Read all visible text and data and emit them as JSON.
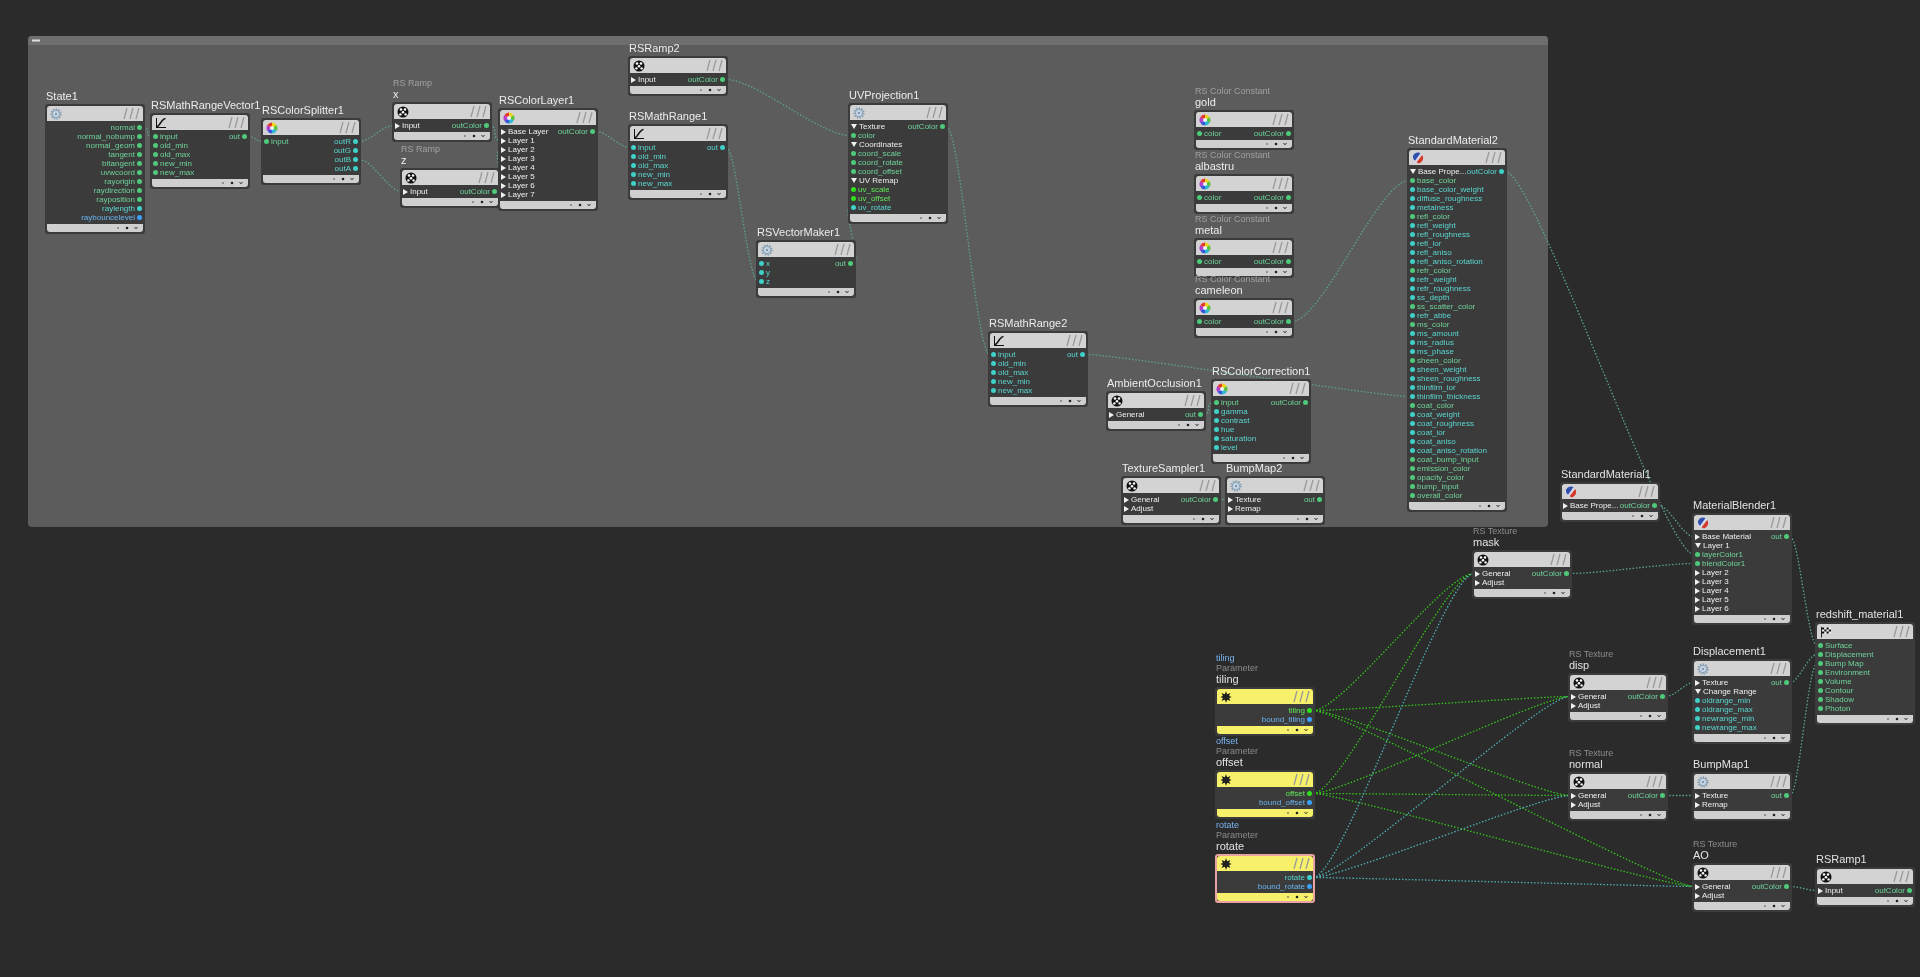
{
  "nodes": [
    {
      "name": "State1",
      "kind": "utility",
      "selected": false,
      "outputs": [
        {
          "label": "normal",
          "kind": "vector"
        },
        {
          "label": "normal_nobump",
          "kind": "vector"
        },
        {
          "label": "normal_geom",
          "kind": "vector"
        },
        {
          "label": "tangent",
          "kind": "vector"
        },
        {
          "label": "bitangent",
          "kind": "vector"
        },
        {
          "label": "uvwcoord",
          "kind": "vector"
        },
        {
          "label": "rayorigin",
          "kind": "vector"
        },
        {
          "label": "raydirection",
          "kind": "vector"
        },
        {
          "label": "rayposition",
          "kind": "vector"
        },
        {
          "label": "raylength",
          "kind": "float"
        },
        {
          "label": "raybouncelevel",
          "kind": "int"
        }
      ]
    },
    {
      "name": "RSMathRangeVector1",
      "kind": "math",
      "selected": false,
      "inputs": [
        {
          "label": "input",
          "kind": "vector"
        },
        {
          "label": "old_min",
          "kind": "vector"
        },
        {
          "label": "old_max",
          "kind": "vector"
        },
        {
          "label": "new_min",
          "kind": "vector"
        },
        {
          "label": "new_max",
          "kind": "vector"
        }
      ],
      "outputs": [
        {
          "label": "out",
          "kind": "vector"
        }
      ]
    },
    {
      "name": "RSColorSplitter1",
      "kind": "color",
      "selected": false,
      "inputs": [
        {
          "label": "input",
          "kind": "vector"
        }
      ],
      "outputs": [
        {
          "label": "outR",
          "kind": "float"
        },
        {
          "label": "outG",
          "kind": "float"
        },
        {
          "label": "outB",
          "kind": "float"
        },
        {
          "label": "outA",
          "kind": "float"
        }
      ]
    },
    {
      "name": "x",
      "type_label": "RS Ramp",
      "kind": "sampler",
      "selected": false,
      "inputs": [
        {
          "label": "Input",
          "kind": "branch"
        }
      ],
      "outputs": [
        {
          "label": "outColor",
          "kind": "vector"
        }
      ]
    },
    {
      "name": "z",
      "type_label": "RS Ramp",
      "kind": "sampler",
      "selected": false,
      "inputs": [
        {
          "label": "Input",
          "kind": "branch"
        }
      ],
      "outputs": [
        {
          "label": "outColor",
          "kind": "vector"
        }
      ]
    },
    {
      "name": "RSColorLayer1",
      "kind": "color",
      "selected": false,
      "inputs": [
        {
          "label": "Base Layer",
          "kind": "branch"
        },
        {
          "label": "Layer 1",
          "kind": "branch"
        },
        {
          "label": "Layer 2",
          "kind": "branch"
        },
        {
          "label": "Layer 3",
          "kind": "branch"
        },
        {
          "label": "Layer 4",
          "kind": "branch"
        },
        {
          "label": "Layer 5",
          "kind": "branch"
        },
        {
          "label": "Layer 6",
          "kind": "branch"
        },
        {
          "label": "Layer 7",
          "kind": "branch"
        }
      ],
      "outputs": [
        {
          "label": "outColor",
          "kind": "vector"
        }
      ]
    },
    {
      "name": "RSRamp2",
      "kind": "sampler",
      "selected": false,
      "inputs": [
        {
          "label": "Input",
          "kind": "branch"
        }
      ],
      "outputs": [
        {
          "label": "outColor",
          "kind": "vector"
        }
      ]
    },
    {
      "name": "RSMathRange1",
      "kind": "math",
      "selected": false,
      "inputs": [
        {
          "label": "input",
          "kind": "float"
        },
        {
          "label": "old_min",
          "kind": "float"
        },
        {
          "label": "old_max",
          "kind": "float"
        },
        {
          "label": "new_min",
          "kind": "float"
        },
        {
          "label": "new_max",
          "kind": "float"
        }
      ],
      "outputs": [
        {
          "label": "out",
          "kind": "float"
        }
      ]
    },
    {
      "name": "UVProjection1",
      "kind": "utility",
      "selected": false,
      "inputs": [
        {
          "label": "Texture",
          "kind": "section"
        },
        {
          "label": "color",
          "kind": "vector"
        },
        {
          "label": "Coordinates",
          "kind": "section"
        },
        {
          "label": "coord_scale",
          "kind": "vector"
        },
        {
          "label": "coord_rotate",
          "kind": "vector"
        },
        {
          "label": "coord_offset",
          "kind": "vector"
        },
        {
          "label": "UV Remap",
          "kind": "section"
        },
        {
          "label": "uv_scale",
          "kind": "bright"
        },
        {
          "label": "uv_offset",
          "kind": "bright"
        },
        {
          "label": "uv_rotate",
          "kind": "float"
        }
      ],
      "outputs": [
        {
          "label": "outColor",
          "kind": "vector"
        }
      ]
    },
    {
      "name": "RSVectorMaker1",
      "kind": "utility",
      "selected": false,
      "inputs": [
        {
          "label": "x",
          "kind": "float"
        },
        {
          "label": "y",
          "kind": "float"
        },
        {
          "label": "z",
          "kind": "float"
        }
      ],
      "outputs": [
        {
          "label": "out",
          "kind": "vector"
        }
      ]
    },
    {
      "name": "gold",
      "type_label": "RS Color Constant",
      "kind": "color",
      "selected": false,
      "inputs": [
        {
          "label": "color",
          "kind": "vector"
        }
      ],
      "outputs": [
        {
          "label": "outColor",
          "kind": "vector"
        }
      ]
    },
    {
      "name": "albastru",
      "type_label": "RS Color Constant",
      "kind": "color",
      "selected": false,
      "inputs": [
        {
          "label": "color",
          "kind": "vector"
        }
      ],
      "outputs": [
        {
          "label": "outColor",
          "kind": "vector"
        }
      ]
    },
    {
      "name": "metal",
      "type_label": "RS Color Constant",
      "kind": "color",
      "selected": false,
      "inputs": [
        {
          "label": "color",
          "kind": "vector"
        }
      ],
      "outputs": [
        {
          "label": "outColor",
          "kind": "vector"
        }
      ]
    },
    {
      "name": "cameleon",
      "type_label": "RS Color Constant",
      "kind": "color",
      "selected": false,
      "inputs": [
        {
          "label": "color",
          "kind": "vector"
        }
      ],
      "outputs": [
        {
          "label": "outColor",
          "kind": "vector"
        }
      ]
    },
    {
      "name": "StandardMaterial2",
      "kind": "material",
      "selected": false,
      "inputs": [
        {
          "label": "Base Prope...",
          "kind": "section"
        },
        {
          "label": "base_color",
          "kind": "vector"
        },
        {
          "label": "base_color_weight",
          "kind": "float"
        },
        {
          "label": "diffuse_roughness",
          "kind": "float"
        },
        {
          "label": "metalness",
          "kind": "float"
        },
        {
          "label": "refl_color",
          "kind": "vector"
        },
        {
          "label": "refl_weight",
          "kind": "float"
        },
        {
          "label": "refl_roughness",
          "kind": "float"
        },
        {
          "label": "refl_ior",
          "kind": "float"
        },
        {
          "label": "refl_aniso",
          "kind": "float"
        },
        {
          "label": "refl_aniso_rotation",
          "kind": "float"
        },
        {
          "label": "refr_color",
          "kind": "vector"
        },
        {
          "label": "refr_weight",
          "kind": "float"
        },
        {
          "label": "refr_roughness",
          "kind": "float"
        },
        {
          "label": "ss_depth",
          "kind": "float"
        },
        {
          "label": "ss_scatter_color",
          "kind": "vector"
        },
        {
          "label": "refr_abbe",
          "kind": "float"
        },
        {
          "label": "ms_color",
          "kind": "vector"
        },
        {
          "label": "ms_amount",
          "kind": "float"
        },
        {
          "label": "ms_radius",
          "kind": "float"
        },
        {
          "label": "ms_phase",
          "kind": "float"
        },
        {
          "label": "sheen_color",
          "kind": "vector"
        },
        {
          "label": "sheen_weight",
          "kind": "float"
        },
        {
          "label": "sheen_roughness",
          "kind": "float"
        },
        {
          "label": "thinfilm_ior",
          "kind": "float"
        },
        {
          "label": "thinfilm_thickness",
          "kind": "float"
        },
        {
          "label": "coat_color",
          "kind": "vector"
        },
        {
          "label": "coat_weight",
          "kind": "float"
        },
        {
          "label": "coat_roughness",
          "kind": "float"
        },
        {
          "label": "coat_ior",
          "kind": "float"
        },
        {
          "label": "coat_aniso",
          "kind": "float"
        },
        {
          "label": "coat_aniso_rotation",
          "kind": "float"
        },
        {
          "label": "coat_bump_input",
          "kind": "vector"
        },
        {
          "label": "emission_color",
          "kind": "vector"
        },
        {
          "label": "opacity_color",
          "kind": "vector"
        },
        {
          "label": "bump_input",
          "kind": "vector"
        },
        {
          "label": "overall_color",
          "kind": "vector"
        }
      ],
      "outputs": [
        {
          "label": "outColor",
          "kind": "float"
        }
      ]
    },
    {
      "name": "RSMathRange2",
      "kind": "math",
      "selected": false,
      "inputs": [
        {
          "label": "input",
          "kind": "float"
        },
        {
          "label": "old_min",
          "kind": "float"
        },
        {
          "label": "old_max",
          "kind": "float"
        },
        {
          "label": "new_min",
          "kind": "float"
        },
        {
          "label": "new_max",
          "kind": "float"
        }
      ],
      "outputs": [
        {
          "label": "out",
          "kind": "float"
        }
      ]
    },
    {
      "name": "AmbientOcclusion1",
      "kind": "sampler",
      "selected": false,
      "inputs": [
        {
          "label": "General",
          "kind": "branch"
        }
      ],
      "outputs": [
        {
          "label": "out",
          "kind": "vector"
        }
      ]
    },
    {
      "name": "RSColorCorrection1",
      "kind": "color",
      "selected": false,
      "inputs": [
        {
          "label": "input",
          "kind": "vector"
        },
        {
          "label": "gamma",
          "kind": "float"
        },
        {
          "label": "contrast",
          "kind": "float"
        },
        {
          "label": "hue",
          "kind": "float"
        },
        {
          "label": "saturation",
          "kind": "float"
        },
        {
          "label": "level",
          "kind": "float"
        }
      ],
      "outputs": [
        {
          "label": "outColor",
          "kind": "vector"
        }
      ]
    },
    {
      "name": "TextureSampler1",
      "kind": "sampler",
      "selected": false,
      "inputs": [
        {
          "label": "General",
          "kind": "branch"
        },
        {
          "label": "Adjust",
          "kind": "branch"
        }
      ],
      "outputs": [
        {
          "label": "outColor",
          "kind": "vector"
        }
      ]
    },
    {
      "name": "BumpMap2",
      "kind": "utility",
      "selected": false,
      "inputs": [
        {
          "label": "Texture",
          "kind": "branch"
        },
        {
          "label": "Remap",
          "kind": "branch"
        }
      ],
      "outputs": [
        {
          "label": "out",
          "kind": "vector"
        }
      ]
    },
    {
      "name": "StandardMaterial1",
      "kind": "material",
      "selected": false,
      "inputs": [
        {
          "label": "Base Prope...",
          "kind": "branch"
        }
      ],
      "outputs": [
        {
          "label": "outColor",
          "kind": "vector"
        }
      ]
    },
    {
      "name": "mask",
      "type_label": "RS Texture",
      "kind": "sampler",
      "selected": false,
      "inputs": [
        {
          "label": "General",
          "kind": "branch"
        },
        {
          "label": "Adjust",
          "kind": "branch"
        }
      ],
      "outputs": [
        {
          "label": "outColor",
          "kind": "vector"
        }
      ]
    },
    {
      "name": "MaterialBlender1",
      "kind": "material",
      "selected": false,
      "inputs": [
        {
          "label": "Base Material",
          "kind": "branch"
        },
        {
          "label": "Layer 1",
          "kind": "section"
        },
        {
          "label": "layerColor1",
          "kind": "vector"
        },
        {
          "label": "blendColor1",
          "kind": "vector"
        },
        {
          "label": "Layer 2",
          "kind": "branch"
        },
        {
          "label": "Layer 3",
          "kind": "branch"
        },
        {
          "label": "Layer 4",
          "kind": "branch"
        },
        {
          "label": "Layer 5",
          "kind": "branch"
        },
        {
          "label": "Layer 6",
          "kind": "branch"
        }
      ],
      "outputs": [
        {
          "label": "out",
          "kind": "vector"
        }
      ]
    },
    {
      "name": "redshift_material1",
      "kind": "output",
      "selected": false,
      "inputs": [
        {
          "label": "Surface",
          "kind": "vector"
        },
        {
          "label": "Displacement",
          "kind": "vector"
        },
        {
          "label": "Bump Map",
          "kind": "vector"
        },
        {
          "label": "Environment",
          "kind": "vector"
        },
        {
          "label": "Volume",
          "kind": "vector"
        },
        {
          "label": "Contour",
          "kind": "vector"
        },
        {
          "label": "Shadow",
          "kind": "vector"
        },
        {
          "label": "Photon",
          "kind": "vector"
        }
      ]
    },
    {
      "name": "tiling",
      "parameter_name": "tiling",
      "type_label": "Parameter",
      "kind": "parameter",
      "selected": false,
      "outputs": [
        {
          "label": "tiling",
          "kind": "bright"
        },
        {
          "label": "bound_tiling",
          "kind": "int"
        }
      ]
    },
    {
      "name": "disp",
      "type_label": "RS Texture",
      "kind": "sampler",
      "selected": false,
      "inputs": [
        {
          "label": "General",
          "kind": "branch"
        },
        {
          "label": "Adjust",
          "kind": "branch"
        }
      ],
      "outputs": [
        {
          "label": "outColor",
          "kind": "vector"
        }
      ]
    },
    {
      "name": "Displacement1",
      "kind": "utility",
      "selected": false,
      "inputs": [
        {
          "label": "Texture",
          "kind": "branch"
        },
        {
          "label": "Change Range",
          "kind": "section"
        },
        {
          "label": "oldrange_min",
          "kind": "float"
        },
        {
          "label": "oldrange_max",
          "kind": "float"
        },
        {
          "label": "newrange_min",
          "kind": "float"
        },
        {
          "label": "newrange_max",
          "kind": "float"
        }
      ],
      "outputs": [
        {
          "label": "out",
          "kind": "vector"
        }
      ]
    },
    {
      "name": "offset",
      "parameter_name": "offset",
      "type_label": "Parameter",
      "kind": "parameter",
      "selected": false,
      "outputs": [
        {
          "label": "offset",
          "kind": "bright"
        },
        {
          "label": "bound_offset",
          "kind": "int"
        }
      ]
    },
    {
      "name": "normal",
      "type_label": "RS Texture",
      "kind": "sampler",
      "selected": false,
      "inputs": [
        {
          "label": "General",
          "kind": "branch"
        },
        {
          "label": "Adjust",
          "kind": "branch"
        }
      ],
      "outputs": [
        {
          "label": "outColor",
          "kind": "vector"
        }
      ]
    },
    {
      "name": "BumpMap1",
      "kind": "utility",
      "selected": false,
      "inputs": [
        {
          "label": "Texture",
          "kind": "branch"
        },
        {
          "label": "Remap",
          "kind": "branch"
        }
      ],
      "outputs": [
        {
          "label": "out",
          "kind": "vector"
        }
      ]
    },
    {
      "name": "rotate",
      "parameter_name": "rotate",
      "type_label": "Parameter",
      "kind": "parameter",
      "selected": true,
      "outputs": [
        {
          "label": "rotate",
          "kind": "float"
        },
        {
          "label": "bound_rotate",
          "kind": "int"
        }
      ]
    },
    {
      "name": "AO",
      "type_label": "RS Texture",
      "kind": "sampler",
      "selected": false,
      "inputs": [
        {
          "label": "General",
          "kind": "branch"
        },
        {
          "label": "Adjust",
          "kind": "branch"
        }
      ],
      "outputs": [
        {
          "label": "outColor",
          "kind": "vector"
        }
      ]
    },
    {
      "name": "RSRamp1",
      "kind": "sampler",
      "selected": false,
      "inputs": [
        {
          "label": "Input",
          "kind": "branch"
        }
      ],
      "outputs": [
        {
          "label": "outColor",
          "kind": "vector"
        }
      ]
    }
  ]
}
